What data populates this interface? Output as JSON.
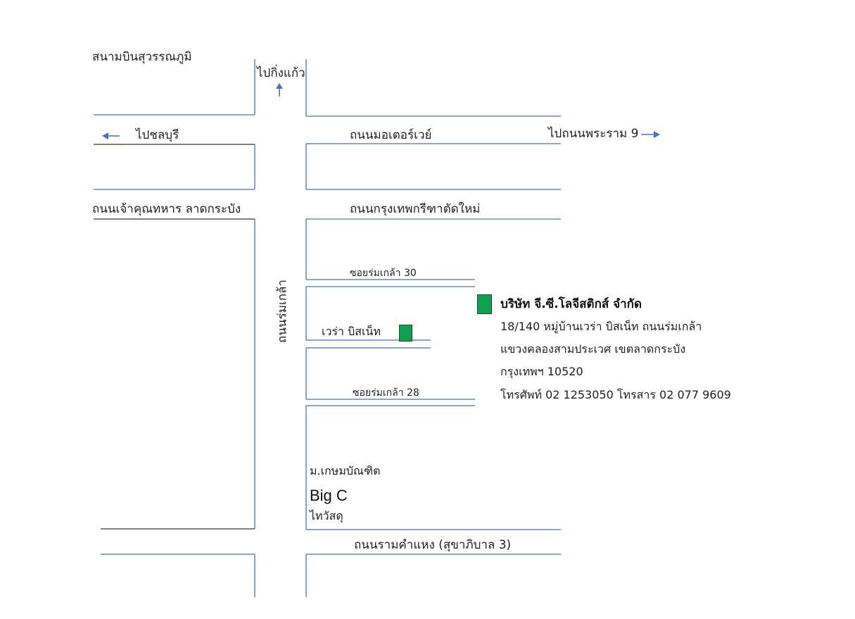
{
  "labels": {
    "airport": "สนามบินสุวรรณภูมิ",
    "to_king_kaeo": "ไปกิ่งแก้ว",
    "to_chonburi": "ไปชลบุรี",
    "motorway": "ถนนมอเตอร์เวย์",
    "to_rama9": "ไปถนนพระราม 9",
    "chaokhun_road": "ถนนเจ้าคุณทหาร ลาดกระบัง",
    "krungthep_kreetha": "ถนนกรุงเทพกรีฑาตัดใหม่",
    "soi_30": "ซอยร่มเกล้า 30",
    "romklao_road": "ถนนร่มเกล้า",
    "varra_business": "เวร่า บิสเน็ท",
    "soi_28": "ซอยร่มเกล้า 28",
    "kasem_bundit": "ม.เกษมบัณฑิต",
    "big_c": "Big C",
    "thai_watsadu": "ไทวัสดุ",
    "ramkhamhaeng": "ถนนรามคำแหง (สุขาภิบาล 3)"
  },
  "company": {
    "name": "บริษัท จี.ซี.โลจีสติกส์ จำกัด",
    "address_line1": "18/140 หมู่บ้านเวร่า บิสเน็ท  ถนนร่มเกล้า",
    "address_line2": "แขวงคลองสามประเวศ เขตลาดกระบัง",
    "address_line3": "กรุงเทพฯ 10520",
    "phone_line": "โทรศัพท์  02 1253050   โทรสาร  02 077 9609"
  },
  "colors": {
    "road_line": "#4a72b8",
    "dark_line": "#333333",
    "marker_fill": "#10a050",
    "arrow": "#4a72b8"
  },
  "icons": {
    "arrow_up": "arrow-up-icon",
    "arrow_left": "arrow-left-icon",
    "arrow_right": "arrow-right-icon",
    "location_marker": "location-marker-icon"
  }
}
